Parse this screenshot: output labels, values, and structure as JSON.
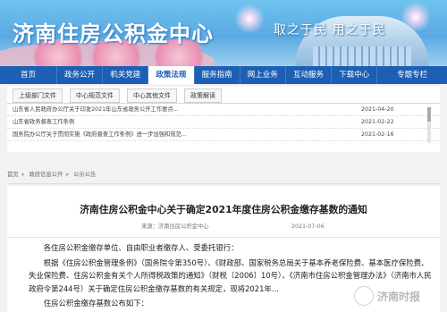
{
  "banner": {
    "title": "济南住房公积金中心",
    "slogan": "取之于民 用之于民"
  },
  "nav": {
    "items": [
      {
        "label": "首页"
      },
      {
        "label": "政务公开"
      },
      {
        "label": "机关党建"
      },
      {
        "label": "政策法规",
        "active": true
      },
      {
        "label": "服务指南"
      },
      {
        "label": "网上业务"
      },
      {
        "label": "互动服务"
      },
      {
        "label": "下载中心"
      },
      {
        "label": "专题专栏"
      }
    ]
  },
  "subnav": {
    "items": [
      {
        "label": "上级部门文件"
      },
      {
        "label": "中心规范文件"
      },
      {
        "label": "中心其他文件"
      },
      {
        "label": "政策解读"
      }
    ]
  },
  "news": {
    "rows": [
      {
        "title": "山东省人民政府办公厅关于印发2021年山东省政务公开工作要点...",
        "date": "2021-04-20"
      },
      {
        "title": "山东省政务督查工作条例",
        "date": "2021-02-22"
      },
      {
        "title": "国务院办公厅关于贯彻实施《政府督查工作条例》进一步加强和规范...",
        "date": "2021-02-16"
      }
    ]
  },
  "breadcrumb": {
    "items": [
      "首页",
      "政府信息公开",
      "公示公告"
    ]
  },
  "article": {
    "title": "济南住房公积金中心关于确定2021年度住房公积金缴存基数的通知",
    "source": "来源：济南住房公积金中心",
    "date": "2021-07-06",
    "para1": "各住房公积金缴存单位、自由职业者缴存人、受委托银行：",
    "para2": "根据《住房公积金管理条例》（国务院令第350号）、《财政部、国家税务总局关于基本养老保险费、基本医疗保险费、失业保险费、住房公积金有关个人所得税政策的通知》（财税〔2006〕10号）、《济南市住房公积金管理办法》（济南市人民政府令第244号）关于确定住房公积金缴存基数的有关规定，现将2021年...",
    "para3": "住房公积金缴存基数公布如下："
  },
  "watermark": {
    "text": "济南时报"
  }
}
